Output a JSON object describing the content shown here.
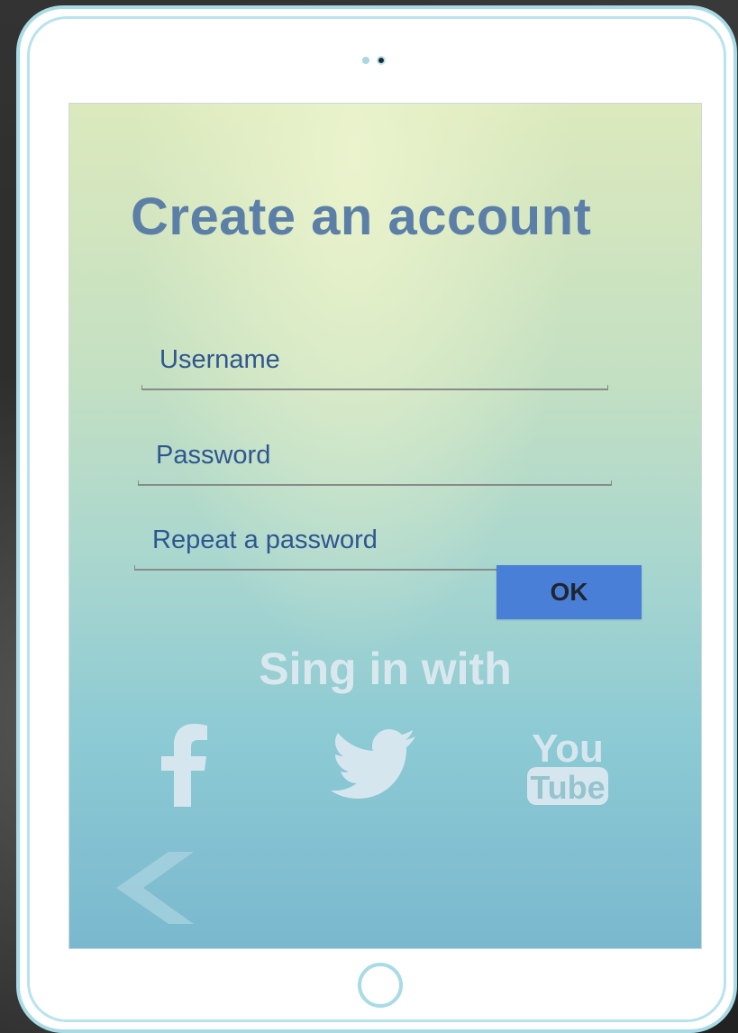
{
  "screen": {
    "title": "Create an account",
    "fields": [
      {
        "label": "Username"
      },
      {
        "label": "Password"
      },
      {
        "label": "Repeat a password"
      }
    ],
    "ok_button": {
      "label": "OK"
    },
    "signin": {
      "label": "Sing in with"
    },
    "social_icons": [
      "facebook-icon",
      "twitter-icon",
      "youtube-icon"
    ],
    "youtube_logo": {
      "top": "You",
      "bottom": "Tube"
    },
    "back_icon": "chevron-left-icon"
  },
  "colors": {
    "title": "#5c7fa8",
    "field_label": "#2f5690",
    "ok_button_bg": "#4a7fd8",
    "frame_border": "#a9dbe6",
    "icon_fill": "#d6e6ee"
  }
}
